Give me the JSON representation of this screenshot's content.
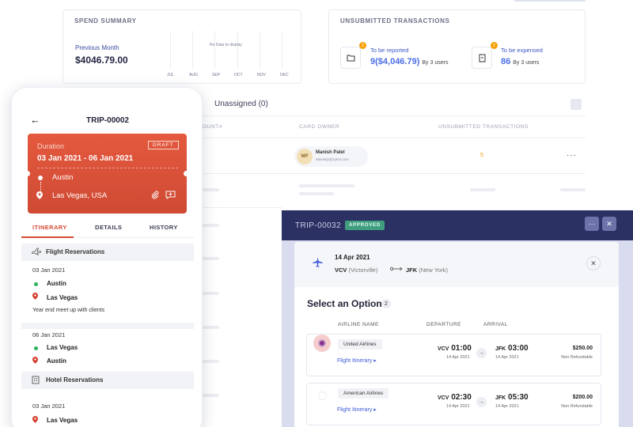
{
  "spend_summary": {
    "title": "SPEND SUMMARY",
    "label": "Previous Month",
    "value": "$4046.79.00",
    "no_data": "No Data to display",
    "months": [
      "JUL",
      "AUG",
      "SEP",
      "OCT",
      "NOV",
      "DEC"
    ]
  },
  "unsubmitted": {
    "title": "UNSUBMITTED TRANSACTIONS",
    "reported": {
      "label": "To be reported",
      "value": "9($4,046.79)",
      "by": "By 3 users",
      "badge": "!"
    },
    "expensed": {
      "label": "To be expensed",
      "value": "86",
      "by": "By 3 users",
      "badge": "!"
    }
  },
  "table": {
    "unassigned": "Unassigned (0)",
    "headers": [
      "OUNT#",
      "CARD OWNER",
      "UNSUBMITTED TRANSACTIONS"
    ],
    "row": {
      "initials": "MP",
      "owner": "Manish Patel",
      "email": "Manishp@zykor.com",
      "count": "5",
      "more": "···"
    }
  },
  "phone": {
    "title": "TRIP-00002",
    "back": "←",
    "card": {
      "duration_label": "Duration",
      "badge": "DRAFT",
      "dates": "03 Jan 2021 - 06 Jan 2021",
      "from": "Austin",
      "to": "Las Vegas, USA"
    },
    "tabs": [
      "ITINERARY",
      "DETAILS",
      "HISTORY"
    ],
    "flight_section": "Flight Reservations",
    "hotel_section": "Hotel Reservations",
    "flight1": {
      "date": "03 Jan 2021",
      "from": "Austin",
      "to": "Las Vegas",
      "note": "Year end meet up with clients"
    },
    "flight2": {
      "date": "06 Jan 2021",
      "from": "Las Vegas",
      "to": "Austin"
    },
    "hotel1": {
      "date": "03 Jan 2021",
      "city": "Las Vegas"
    }
  },
  "modal": {
    "trip_id": "TRIP-00032",
    "status": "APPROVED",
    "more_btn": "···",
    "close_btn": "✕",
    "flight": {
      "date": "14 Apr 2021",
      "from_code": "VCV",
      "from_name": "(Victorville)",
      "to_code": "JFK",
      "to_name": "(New York)"
    },
    "select_title": "Select an Option",
    "option_count": "2",
    "headers": [
      "AIRLINE NAME",
      "DEPARTURE",
      "ARRIVAL"
    ],
    "options": [
      {
        "airline": "United Airlines",
        "link": "Flight Itinerary ▸",
        "dep_code": "VCV",
        "dep_time": "01:00",
        "dep_date": "14 Apr 2021",
        "arr_code": "JFK",
        "arr_time": "03:00",
        "arr_date": "14 Apr 2021",
        "price": "$250.00",
        "refund": "Non Refundable"
      },
      {
        "airline": "American Airlines",
        "link": "Flight Itinerary ▸",
        "dep_code": "VCV",
        "dep_time": "02:30",
        "dep_date": "14 Apr 2021",
        "arr_code": "JFK",
        "arr_time": "05:30",
        "arr_date": "14 Apr 2021",
        "price": "$200.00",
        "refund": "Non Refundable"
      }
    ]
  },
  "colors": {
    "accent": "#4a6de6",
    "trip_card": "#dc553b",
    "modal_header": "#2b3163",
    "approved": "#3f9e7e",
    "warning": "#f5a20a"
  },
  "icons": [
    "folder-icon",
    "receipt-icon",
    "back-arrow-icon",
    "location-pin-icon",
    "attachment-icon",
    "comment-icon",
    "plane-icon",
    "building-icon",
    "swap-arrow-icon",
    "close-icon"
  ]
}
